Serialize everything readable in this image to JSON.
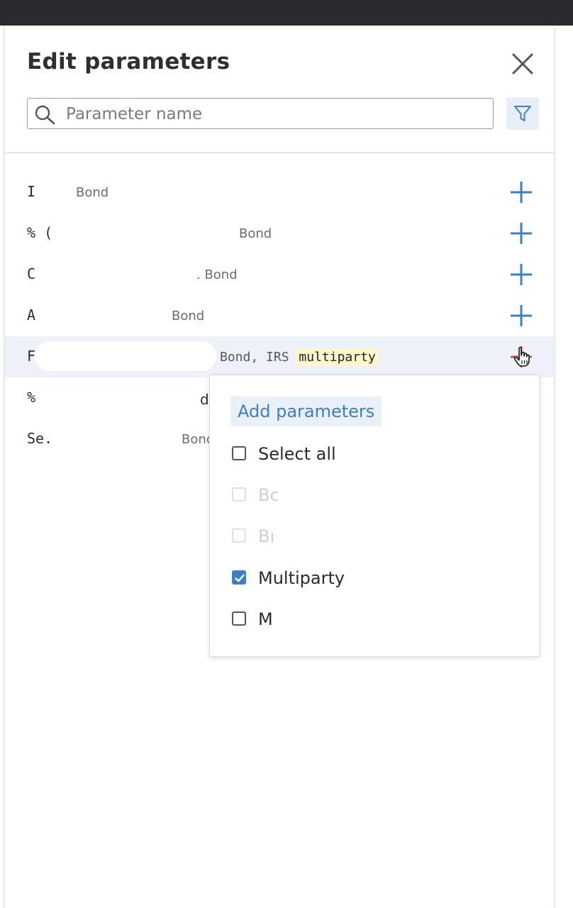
{
  "panel": {
    "title": "Edit parameters",
    "close_icon": "close-icon",
    "search": {
      "placeholder": "Parameter name",
      "value": ""
    },
    "filter_icon": "filter-icon"
  },
  "rows": [
    {
      "name": "I",
      "tags": "Bond"
    },
    {
      "name": "% (",
      "tags": "Bond"
    },
    {
      "name": "C",
      "tags": ". Bond"
    },
    {
      "name": "A",
      "tags": "Bond"
    },
    {
      "name": "F",
      "tags_prefix": "Bond, IRS",
      "tags_highlight": "multiparty"
    },
    {
      "name": "%",
      "tags": "d"
    },
    {
      "name": "Se.",
      "tags": "Bonc"
    }
  ],
  "dropdown": {
    "title": "Add parameters",
    "options": [
      {
        "label": "Select all",
        "checked": false,
        "disabled": false
      },
      {
        "label": "Bc",
        "checked": false,
        "disabled": true
      },
      {
        "label": "Bı",
        "checked": false,
        "disabled": true
      },
      {
        "label": "Multiparty",
        "checked": true,
        "disabled": false
      },
      {
        "label": "M",
        "checked": false,
        "disabled": false
      }
    ]
  },
  "colors": {
    "accent": "#3b7fc6",
    "highlight_row": "#eef2f8",
    "keyword_highlight": "#fff6cc",
    "topbar": "#2a2b2e"
  }
}
